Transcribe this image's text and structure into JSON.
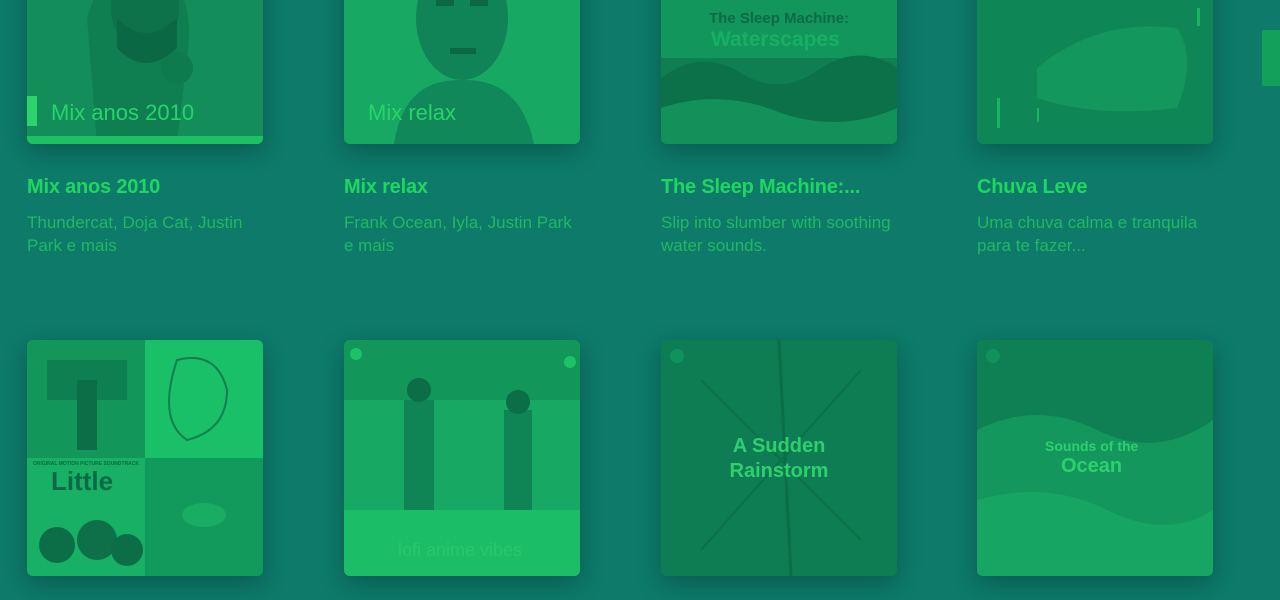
{
  "cards": [
    {
      "title": "Mix anos 2010",
      "description": "Thundercat, Doja Cat, Justin Park e mais",
      "cover_label": "Mix anos 2010"
    },
    {
      "title": "Mix relax",
      "description": "Frank Ocean, Iyla, Justin Park e mais",
      "cover_label": "Mix relax"
    },
    {
      "title": "The Sleep Machine:...",
      "description": "Slip into slumber with soothing water sounds.",
      "cover_label": "The Sleep Machine:",
      "cover_sub": "Waterscapes"
    },
    {
      "title": "Chuva Leve",
      "description": "Uma chuva calma e tranquila para te fazer..."
    },
    {
      "cover_label_main": "Little",
      "cover_label_top": "ORIGINAL MOTION PICTURE SOUNDTRACK"
    },
    {
      "cover_label": "lofi anime vibes"
    },
    {
      "cover_label": "A Sudden Rainstorm"
    },
    {
      "cover_label": "Sounds of the",
      "cover_sub": "Ocean"
    }
  ],
  "colors": {
    "background": "#0d7a6a",
    "title": "#1ed760",
    "subtitle": "#22b863"
  }
}
